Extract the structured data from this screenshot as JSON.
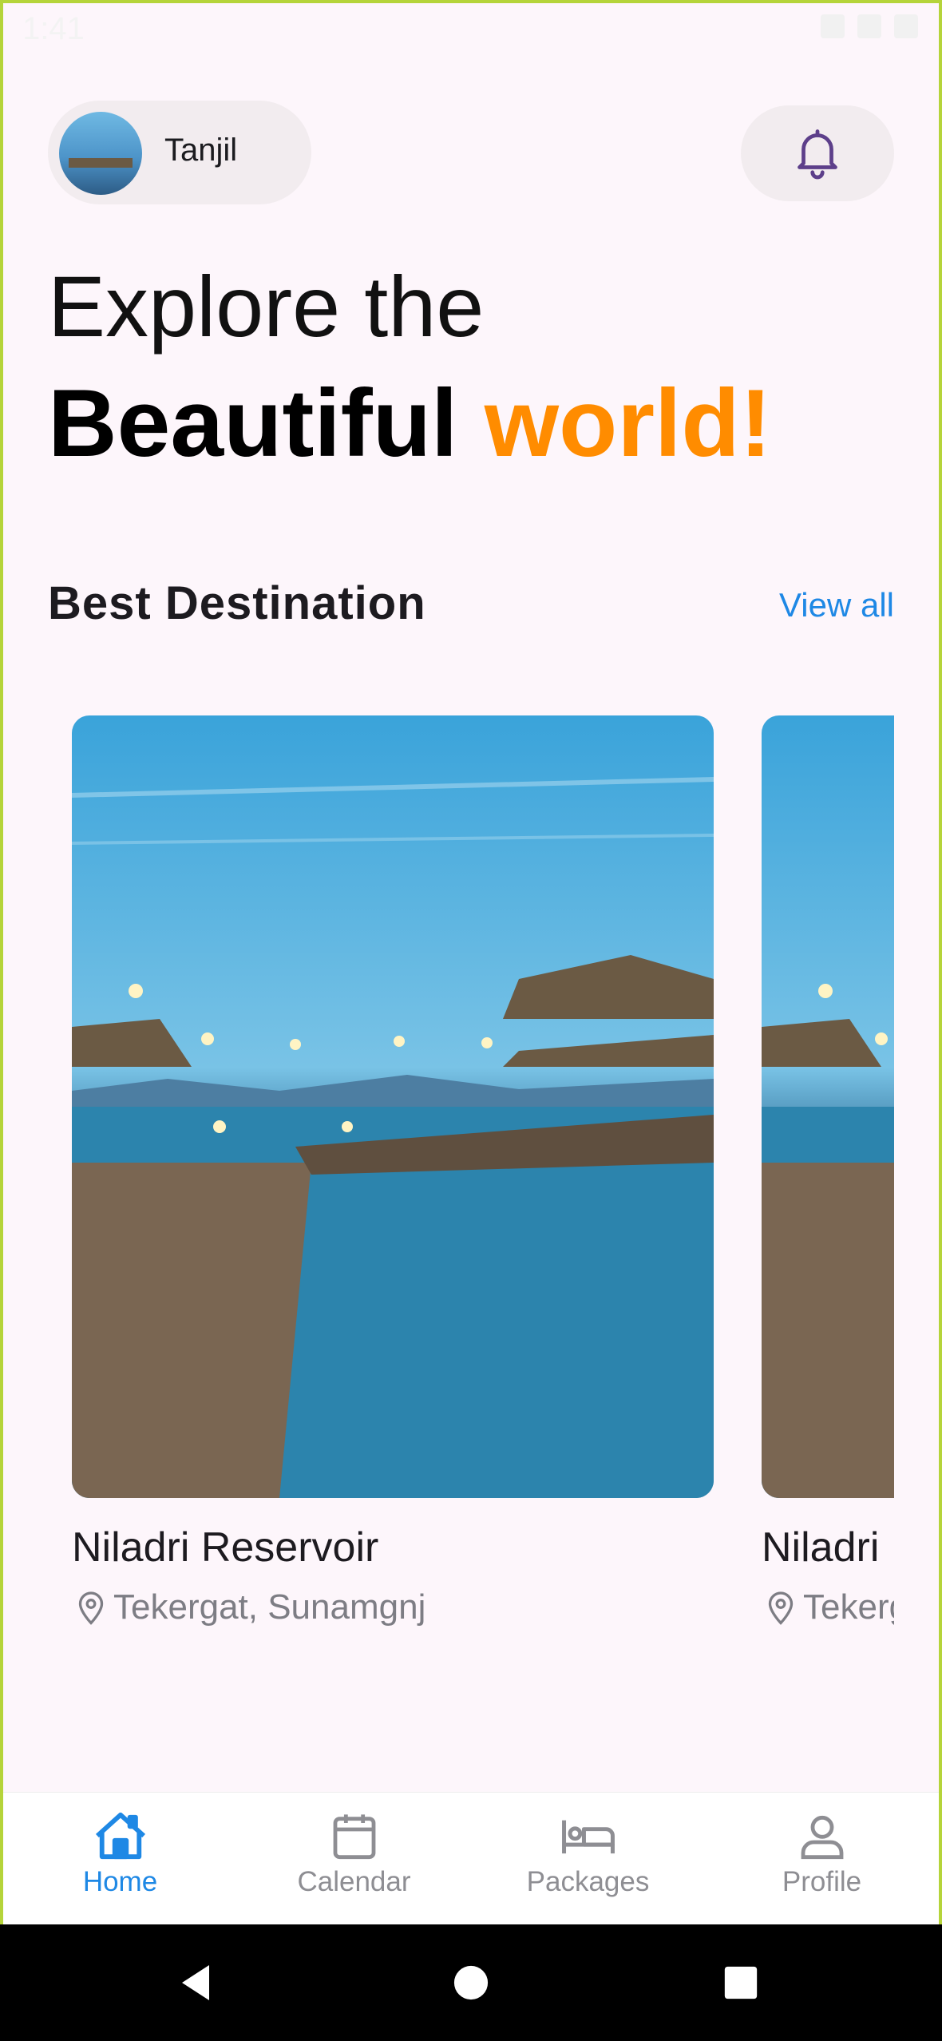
{
  "status_bar": {
    "time": "1:41"
  },
  "user": {
    "name": "Tanjil"
  },
  "headline": {
    "line1": "Explore the",
    "line2_bold": "Beautiful",
    "line2_accent": "world!"
  },
  "section": {
    "title": "Best Destination",
    "view_all": "View all"
  },
  "destinations": [
    {
      "name": "Niladri Reservoir",
      "location": "Tekergat, Sunamgnj"
    },
    {
      "name": "Niladri Reservoir",
      "location": "Tekergat, Sunamgnj"
    }
  ],
  "bottom_nav": {
    "items": [
      {
        "label": "Home",
        "icon": "home-icon",
        "active": true
      },
      {
        "label": "Calendar",
        "icon": "calendar-icon"
      },
      {
        "label": "Packages",
        "icon": "bed-icon"
      },
      {
        "label": "Profile",
        "icon": "person-icon"
      }
    ]
  },
  "colors": {
    "accent": "#ff8c00",
    "primary": "#1e88e5",
    "background": "#fdf6fb"
  }
}
